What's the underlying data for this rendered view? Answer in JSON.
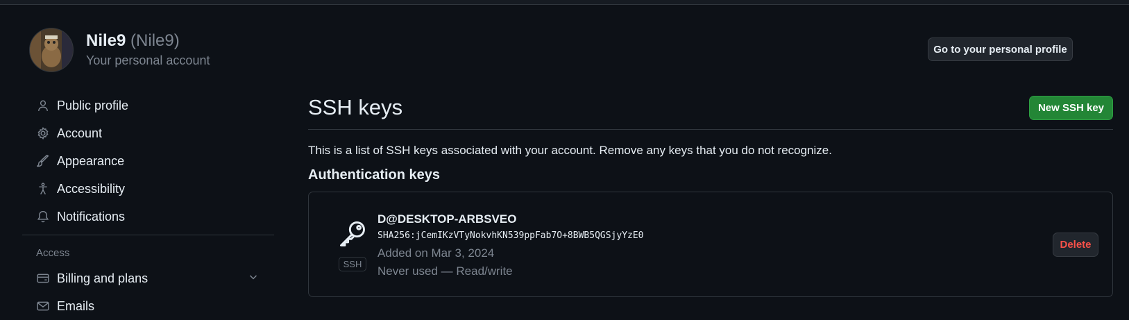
{
  "header": {
    "display_name": "Nile9",
    "login": "(Nile9)",
    "account_type": "Your personal account",
    "profile_button": "Go to your personal profile"
  },
  "sidebar": {
    "items": [
      {
        "label": "Public profile",
        "icon": "person-icon"
      },
      {
        "label": "Account",
        "icon": "gear-icon"
      },
      {
        "label": "Appearance",
        "icon": "paintbrush-icon"
      },
      {
        "label": "Accessibility",
        "icon": "accessibility-icon"
      },
      {
        "label": "Notifications",
        "icon": "bell-icon"
      }
    ],
    "access_heading": "Access",
    "access_items": [
      {
        "label": "Billing and plans",
        "icon": "credit-card-icon",
        "expandable": true
      },
      {
        "label": "Emails",
        "icon": "mail-icon"
      }
    ]
  },
  "main": {
    "title": "SSH keys",
    "new_key_button": "New SSH key",
    "description": "This is a list of SSH keys associated with your account. Remove any keys that you do not recognize.",
    "section_heading": "Authentication keys",
    "keys": [
      {
        "title": "D@DESKTOP-ARBSVEO",
        "fingerprint": "SHA256:jCemIKzVTyNokvhKN539ppFab7O+8BWB5QGSjyYzE0",
        "badge": "SSH",
        "added": "Added on Mar 3, 2024",
        "usage": "Never used — Read/write",
        "delete_label": "Delete"
      }
    ]
  },
  "colors": {
    "background": "#0d1117",
    "primary_button": "#238636",
    "danger_text": "#f85149",
    "muted_text": "#7d8590",
    "border": "#30363d"
  }
}
